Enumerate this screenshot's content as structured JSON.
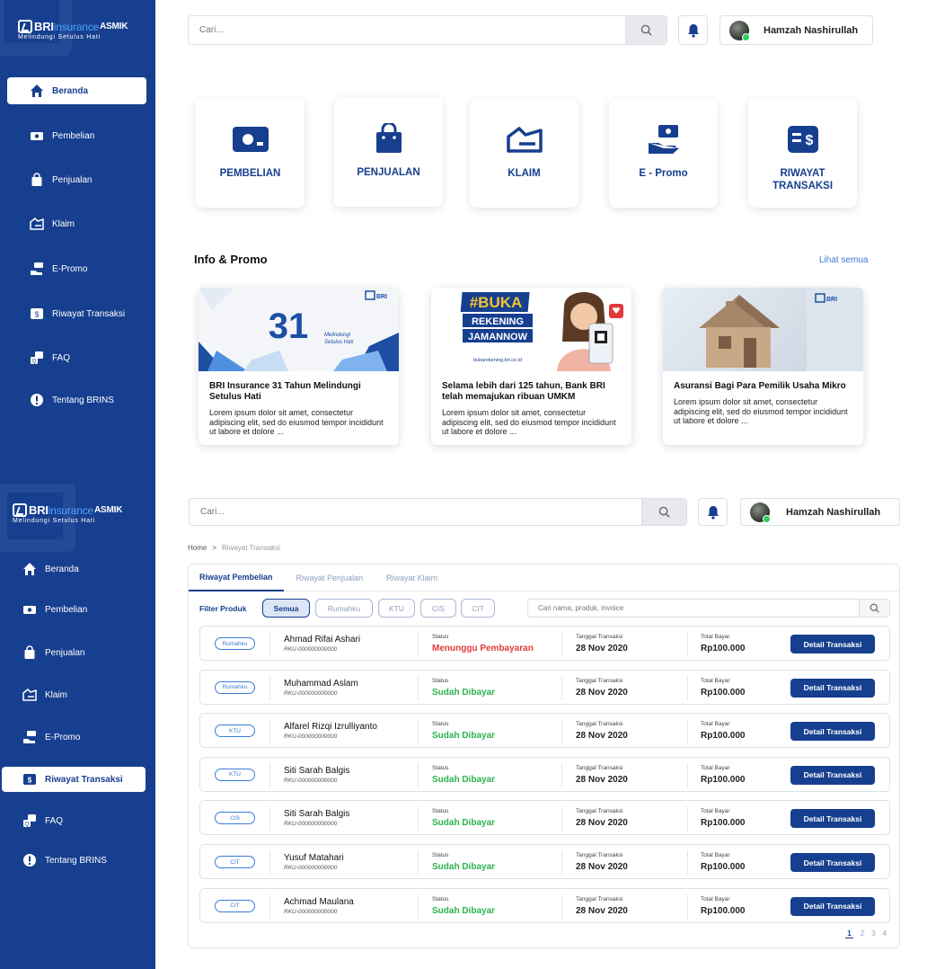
{
  "brand": {
    "name": "BRI",
    "insurance": "insurance",
    "asmik": "ASMIK",
    "tagline": "Melindungi Setulus Hati"
  },
  "search": {
    "placeholder": "Cari..."
  },
  "user": {
    "name": "Hamzah Nashirullah"
  },
  "nav": [
    {
      "key": "beranda",
      "label": "Beranda",
      "icon": "home-icon"
    },
    {
      "key": "pembelian",
      "label": "Pembelian",
      "icon": "money-icon"
    },
    {
      "key": "penjualan",
      "label": "Penjualan",
      "icon": "bag-icon"
    },
    {
      "key": "klaim",
      "label": "Klaim",
      "icon": "check-doc-icon"
    },
    {
      "key": "epromo",
      "label": "E-Promo",
      "icon": "promo-icon"
    },
    {
      "key": "riwayat",
      "label": "Riwayat Transaksi",
      "icon": "receipt-icon"
    },
    {
      "key": "faq",
      "label": "FAQ",
      "icon": "faq-icon"
    },
    {
      "key": "tentang",
      "label": "Tentang BRINS",
      "icon": "info-icon"
    }
  ],
  "tiles": [
    {
      "label": "PEMBELIAN"
    },
    {
      "label": "PENJUALAN"
    },
    {
      "label": "KLAIM"
    },
    {
      "label": "E - Promo"
    },
    {
      "label": "RIWAYAT TRANSAKSI"
    }
  ],
  "info_promo": {
    "title": "Info & Promo",
    "see_all": "Lihat semua",
    "cards": [
      {
        "title": "BRI Insurance 31 Tahun Melindungi Setulus Hati",
        "desc": "Lorem ipsum dolor sit amet, consectetur adipiscing elit, sed do eiusmod tempor incididunt ut labore et dolore ...",
        "img_text": "31",
        "img_sub": "Melindungi Setulus Hati"
      },
      {
        "title": "Selama lebih dari 125 tahun, Bank BRI telah memajukan ribuan UMKM",
        "desc": "Lorem ipsum dolor sit amet, consectetur adipiscing elit, sed do eiusmod tempor incididunt ut labore et dolore ...",
        "img_text": "#BUKA REKENING JAMANNOW",
        "img_sub": "bukarekening.bri.co.id"
      },
      {
        "title": "Asuransi Bagi Para Pemilik Usaha Mikro",
        "desc": "Lorem ipsum dolor sit amet, consectetur adipiscing elit, sed do eiusmod tempor incididunt ut labore et dolore ...",
        "img_text": "",
        "img_sub": ""
      }
    ]
  },
  "breadcrumb": {
    "home": "Home",
    "sep": ">",
    "current": "Riwayat Transaksi"
  },
  "history": {
    "tabs": [
      "Riwayat Pembelian",
      "Riwayat Penjualan",
      "Riwayat Klaim"
    ],
    "filter_label": "Filter Produk",
    "filters": [
      "Semua",
      "Rumahku",
      "KTU",
      "CIS",
      "CIT"
    ],
    "search_placeholder": "Cari nama, produk, invoice",
    "labels": {
      "status": "Status",
      "date": "Tanggal Transaksi",
      "total": "Total Bayar",
      "button": "Detail Transaksi"
    },
    "rows": [
      {
        "product": "Rumahku",
        "name": "Ahmad Rifai Ashari",
        "invoice": "RKU-000000000000",
        "status": "Menunggu Pembayaran",
        "status_type": "wait",
        "date": "28 Nov 2020",
        "total": "Rp100.000"
      },
      {
        "product": "Rumahku",
        "name": "Muhammad Aslam",
        "invoice": "RKU-000000000000",
        "status": "Sudah Dibayar",
        "status_type": "paid",
        "date": "28 Nov 2020",
        "total": "Rp100.000"
      },
      {
        "product": "KTU",
        "name": "Alfarel Rizqi Izrulliyanto",
        "invoice": "RKU-000000000000",
        "status": "Sudah Dibayar",
        "status_type": "paid",
        "date": "28 Nov 2020",
        "total": "Rp100.000"
      },
      {
        "product": "KTU",
        "name": "Siti Sarah Balgis",
        "invoice": "RKU-000000000000",
        "status": "Sudah Dibayar",
        "status_type": "paid",
        "date": "28 Nov 2020",
        "total": "Rp100.000"
      },
      {
        "product": "CIS",
        "name": "Siti Sarah Balgis",
        "invoice": "RKU-000000000000",
        "status": "Sudah Dibayar",
        "status_type": "paid",
        "date": "28 Nov 2020",
        "total": "Rp100.000"
      },
      {
        "product": "CIT",
        "name": "Yusuf Matahari",
        "invoice": "RKU-000000000000",
        "status": "Sudah Dibayar",
        "status_type": "paid",
        "date": "28 Nov 2020",
        "total": "Rp100.000"
      },
      {
        "product": "CIT",
        "name": "Achmad Maulana",
        "invoice": "RKU-000000000000",
        "status": "Sudah Dibayar",
        "status_type": "paid",
        "date": "28 Nov 2020",
        "total": "Rp100.000"
      }
    ],
    "pages": [
      "1",
      "2",
      "3",
      "4"
    ]
  },
  "colors": {
    "primary": "#173f8f",
    "accent": "#3a7bd5",
    "wait": "#e03b3b",
    "paid": "#2bb34d"
  }
}
